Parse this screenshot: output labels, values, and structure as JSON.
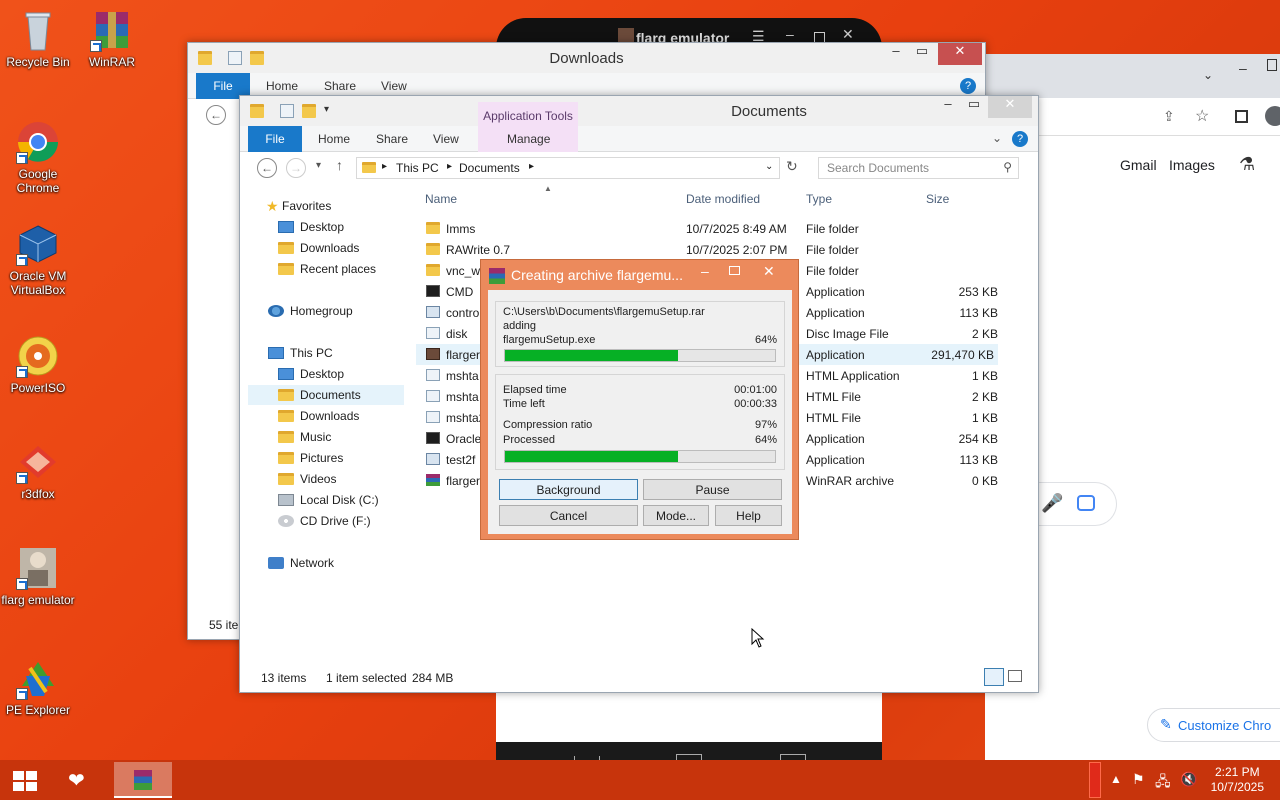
{
  "desktop": {
    "icons": [
      {
        "label": "Recycle Bin"
      },
      {
        "label": "WinRAR"
      },
      {
        "label": "Google Chrome"
      },
      {
        "label": "Oracle VM VirtualBox"
      },
      {
        "label": "PowerISO"
      },
      {
        "label": "r3dfox"
      },
      {
        "label": "flarg emulator"
      },
      {
        "label": "PE Explorer"
      }
    ]
  },
  "chrome": {
    "gmail": "Gmail",
    "images": "Images",
    "customize": "Customize Chro"
  },
  "emulator": {
    "title": "flarg emulator"
  },
  "downloads_window": {
    "title": "Downloads",
    "tabs": [
      "File",
      "Home",
      "Share",
      "View"
    ],
    "status": "55 ite"
  },
  "documents_window": {
    "title": "Documents",
    "context_tab": "Application Tools",
    "tabs": [
      "File",
      "Home",
      "Share",
      "View",
      "Manage"
    ],
    "breadcrumb": [
      "This PC",
      "Documents"
    ],
    "search_placeholder": "Search Documents",
    "columns": [
      "Name",
      "Date modified",
      "Type",
      "Size"
    ],
    "nav": {
      "favorites": "Favorites",
      "fav_items": [
        "Desktop",
        "Downloads",
        "Recent places"
      ],
      "homegroup": "Homegroup",
      "thispc": "This PC",
      "pc_items": [
        "Desktop",
        "Documents",
        "Downloads",
        "Music",
        "Pictures",
        "Videos",
        "Local Disk (C:)",
        "CD Drive (F:)"
      ],
      "network": "Network"
    },
    "files": [
      {
        "name": "Imms",
        "date": "10/7/2025 8:49 AM",
        "type": "File folder",
        "size": ""
      },
      {
        "name": "RAWrite 0.7",
        "date": "10/7/2025 2:07 PM",
        "type": "File folder",
        "size": ""
      },
      {
        "name": "vnc_wi",
        "date": "",
        "type": "File folder",
        "size": ""
      },
      {
        "name": "CMD",
        "date": "",
        "type": "Application",
        "size": "253 KB"
      },
      {
        "name": "contro",
        "date": "",
        "type": "Application",
        "size": "113 KB"
      },
      {
        "name": "disk",
        "date": "",
        "type": "Disc Image File",
        "size": "2 KB"
      },
      {
        "name": "flarger",
        "date": "",
        "type": "Application",
        "size": "291,470 KB"
      },
      {
        "name": "mshta",
        "date": "",
        "type": "HTML Application",
        "size": "1 KB"
      },
      {
        "name": "mshta",
        "date": "",
        "type": "HTML File",
        "size": "2 KB"
      },
      {
        "name": "mshta2",
        "date": "",
        "type": "HTML File",
        "size": "1 KB"
      },
      {
        "name": "Oracle",
        "date": "",
        "type": "Application",
        "size": "254 KB"
      },
      {
        "name": "test2f",
        "date": "",
        "type": "Application",
        "size": "113 KB"
      },
      {
        "name": "flarger",
        "date": "",
        "type": "WinRAR archive",
        "size": "0 KB"
      }
    ],
    "status_items": "13 items",
    "status_selected": "1 item selected",
    "status_size": "284 MB"
  },
  "rar_dialog": {
    "title": "Creating archive flargemu...",
    "path": "C:\\Users\\b\\Documents\\flargemuSetup.rar",
    "action": "adding",
    "file": "flargemuSetup.exe",
    "file_pct": "64%",
    "file_progress": 0.64,
    "elapsed_label": "Elapsed time",
    "elapsed": "00:01:00",
    "left_label": "Time left",
    "left": "00:00:33",
    "ratio_label": "Compression ratio",
    "ratio": "97%",
    "processed_label": "Processed",
    "processed": "64%",
    "processed_progress": 0.64,
    "buttons": {
      "background": "Background",
      "pause": "Pause",
      "cancel": "Cancel",
      "mode": "Mode...",
      "help": "Help"
    }
  },
  "taskbar": {
    "time": "2:21 PM",
    "date": "10/7/2025"
  }
}
